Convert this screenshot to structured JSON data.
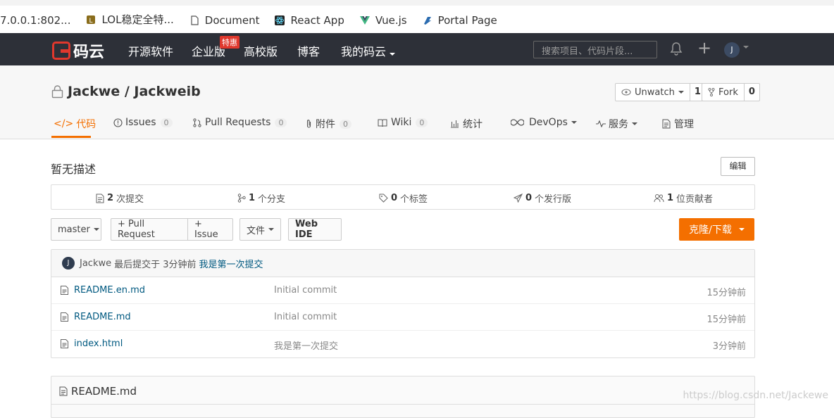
{
  "bookmarks": [
    {
      "label": "7.0.0.1:802...",
      "icon": "page-icon"
    },
    {
      "label": "LOL稳定全特...",
      "icon": "lol-icon"
    },
    {
      "label": "Document",
      "icon": "document-icon"
    },
    {
      "label": "React App",
      "icon": "react-icon"
    },
    {
      "label": "Vue.js",
      "icon": "vue-icon"
    },
    {
      "label": "Portal Page",
      "icon": "portal-icon"
    }
  ],
  "nav": {
    "logo_text": "码云",
    "items": [
      "开源软件",
      "企业版",
      "高校版",
      "博客",
      "我的码云"
    ],
    "badge": "特惠",
    "search_placeholder": "搜索项目、代码片段...",
    "avatar_letter": "J"
  },
  "repo": {
    "title": "Jackwe / Jackweib",
    "unwatch_label": "Unwatch",
    "unwatch_count": "1",
    "fork_label": "Fork",
    "fork_count": "0"
  },
  "tabs": [
    {
      "label": "代码",
      "count": ""
    },
    {
      "label": "Issues",
      "count": "0"
    },
    {
      "label": "Pull Requests",
      "count": "0"
    },
    {
      "label": "附件",
      "count": "0"
    },
    {
      "label": "Wiki",
      "count": "0"
    },
    {
      "label": "统计",
      "count": ""
    },
    {
      "label": "DevOps",
      "count": ""
    },
    {
      "label": "服务",
      "count": ""
    },
    {
      "label": "管理",
      "count": ""
    }
  ],
  "description": "暂无描述",
  "edit_label": "编辑",
  "stats": [
    {
      "num": "2",
      "label": "次提交"
    },
    {
      "num": "1",
      "label": "个分支"
    },
    {
      "num": "0",
      "label": "个标签"
    },
    {
      "num": "0",
      "label": "个发行版"
    },
    {
      "num": "1",
      "label": "位贡献者"
    }
  ],
  "toolbar": {
    "branch": "master",
    "pull_request": "+ Pull Request",
    "issue": "+ Issue",
    "files": "文件",
    "webide": "Web IDE",
    "clone": "克隆/下载"
  },
  "last_commit": {
    "avatar": "J",
    "author": "Jackwe",
    "text": "最后提交于 3分钟前",
    "message": "我是第一次提交"
  },
  "files": [
    {
      "name": "README.en.md",
      "message": "Initial commit",
      "time": "15分钟前"
    },
    {
      "name": "README.md",
      "message": "Initial commit",
      "time": "15分钟前"
    },
    {
      "name": "index.html",
      "message": "我是第一次提交",
      "time": "3分钟前"
    }
  ],
  "readme_title": "README.md",
  "watermark": "https://blog.csdn.net/Jackewe",
  "colors": {
    "accent": "#f46f00",
    "nav_bg": "#2d3038",
    "link": "#005980"
  }
}
